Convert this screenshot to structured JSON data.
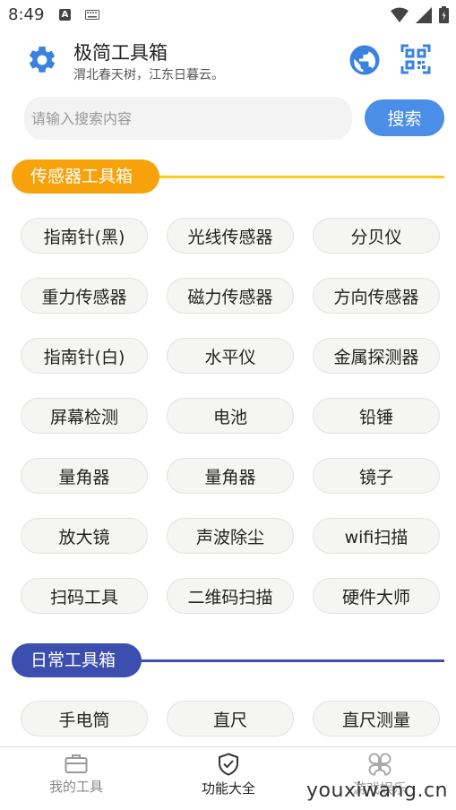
{
  "status_bar": {
    "time": "8:49",
    "notif_letter": "A"
  },
  "header": {
    "title": "极简工具箱",
    "subtitle": "渭北春天树，江东日暮云。"
  },
  "search": {
    "placeholder": "请输入搜索内容",
    "button_label": "搜索"
  },
  "sections": [
    {
      "title": "传感器工具箱",
      "accent_color": "#f7a20b",
      "items": [
        "指南针(黑)",
        "光线传感器",
        "分贝仪",
        "重力传感器",
        "磁力传感器",
        "方向传感器",
        "指南针(白)",
        "水平仪",
        "金属探测器",
        "屏幕检测",
        "电池",
        "铅锤",
        "量角器",
        "量角器",
        "镜子",
        "放大镜",
        "声波除尘",
        "wifi扫描",
        "扫码工具",
        "二维码扫描",
        "硬件大师"
      ]
    },
    {
      "title": "日常工具箱",
      "accent_color": "#3c4fae",
      "items": [
        "手电筒",
        "直尺",
        "直尺测量"
      ]
    }
  ],
  "bottom_nav": {
    "items": [
      {
        "label": "我的工具",
        "icon": "briefcase-icon",
        "active": false
      },
      {
        "label": "功能大全",
        "icon": "shield-check-icon",
        "active": true
      },
      {
        "label": "游戏娱乐",
        "icon": "grid-4-icon",
        "active": false
      }
    ]
  },
  "watermark": "youxiwang.cn",
  "colors": {
    "primary_blue": "#4a8ee8",
    "search_bg": "#f2f3f2"
  }
}
